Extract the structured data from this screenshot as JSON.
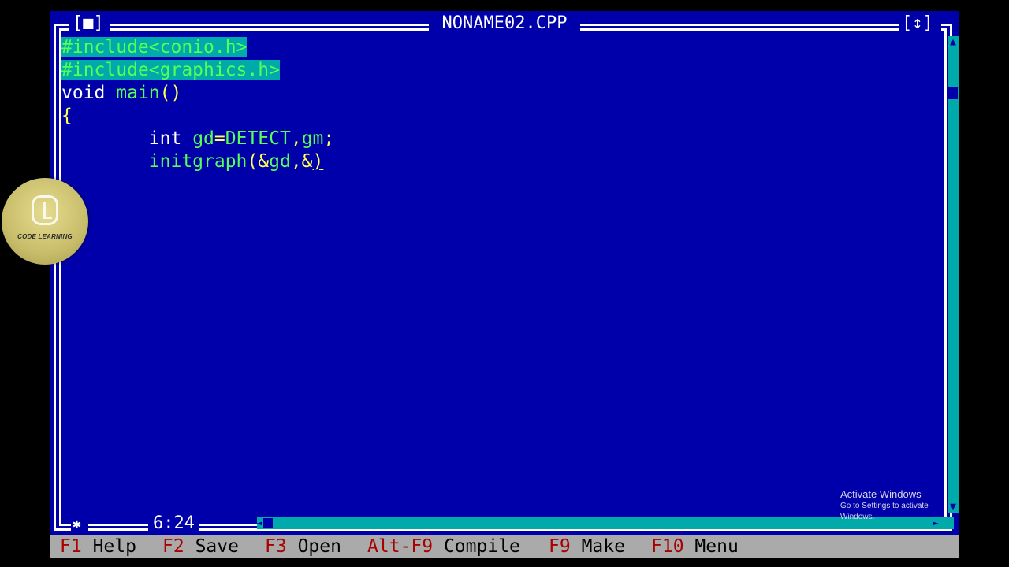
{
  "window": {
    "title": "NONAME02.CPP",
    "close_button_label": "[■]",
    "zoom_button_label": "[↕]"
  },
  "editor": {
    "lines": [
      {
        "parts": [
          {
            "text": "#include<conio.h>",
            "style": "hl"
          }
        ]
      },
      {
        "parts": [
          {
            "text": "#include<graphics.h>",
            "style": "hl"
          }
        ]
      },
      {
        "parts": [
          {
            "text": "void",
            "style": "kw"
          },
          {
            "text": " ",
            "style": "pn"
          },
          {
            "text": "main",
            "style": "id"
          },
          {
            "text": "()",
            "style": "pn"
          }
        ]
      },
      {
        "parts": [
          {
            "text": "{",
            "style": "pn"
          }
        ]
      },
      {
        "parts": [
          {
            "text": "        ",
            "style": "pn"
          },
          {
            "text": "int",
            "style": "kw"
          },
          {
            "text": " ",
            "style": "pn"
          },
          {
            "text": "gd",
            "style": "id"
          },
          {
            "text": "=",
            "style": "pn"
          },
          {
            "text": "DETECT",
            "style": "id"
          },
          {
            "text": ",",
            "style": "pn"
          },
          {
            "text": "gm",
            "style": "id"
          },
          {
            "text": ";",
            "style": "pn"
          }
        ]
      },
      {
        "parts": [
          {
            "text": "        ",
            "style": "pn"
          },
          {
            "text": "initgraph",
            "style": "id"
          },
          {
            "text": "(&",
            "style": "pn"
          },
          {
            "text": "gd",
            "style": "id"
          },
          {
            "text": ",&",
            "style": "pn"
          },
          {
            "text": ")",
            "style": "pn cursor"
          }
        ]
      }
    ]
  },
  "status": {
    "cursor_position": "6:24",
    "marker": "✱"
  },
  "menubar": {
    "items": [
      {
        "key": "F1",
        "label": "Help"
      },
      {
        "key": "F2",
        "label": "Save"
      },
      {
        "key": "F3",
        "label": "Open"
      },
      {
        "key": "Alt-F9",
        "label": "Compile"
      },
      {
        "key": "F9",
        "label": "Make"
      },
      {
        "key": "F10",
        "label": "Menu"
      }
    ]
  },
  "watermark": {
    "line1": "Activate Windows",
    "line2": "Go to Settings to activate Windows."
  },
  "logo": {
    "text": "CODE LEARNING"
  },
  "colors": {
    "editor_bg": "#0000aa",
    "highlight_bg": "#00aaaa",
    "keyword": "#ffffff",
    "identifier": "#55ff55",
    "punctuation": "#ffff55",
    "menubar_bg": "#aaaaaa",
    "menubar_key": "#aa0000"
  }
}
